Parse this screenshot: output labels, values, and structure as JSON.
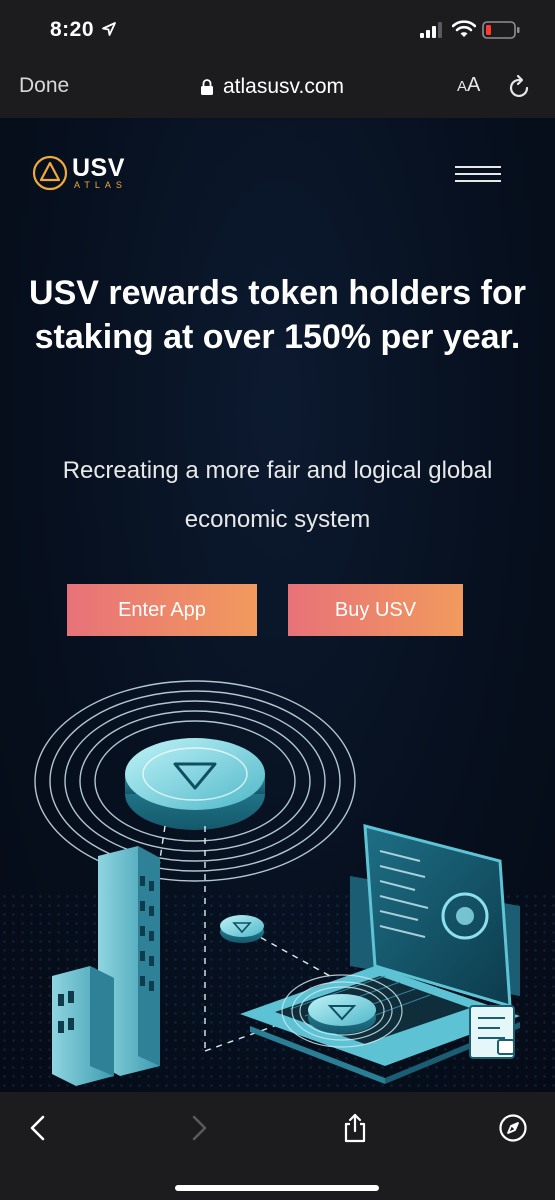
{
  "status_bar": {
    "time": "8:20"
  },
  "browser": {
    "done_label": "Done",
    "url": "atlasusv.com",
    "text_size_small": "A",
    "text_size_large": "A"
  },
  "site": {
    "logo_main": "USV",
    "logo_sub": "ATLAS",
    "headline": "USV rewards token holders for staking at over 150% per year.",
    "subheadline": "Recreating a more fair and logical global economic system",
    "enter_app_label": "Enter App",
    "buy_usv_label": "Buy USV"
  },
  "colors": {
    "accent_gold": "#f0a93b",
    "button_gradient_start": "#e87279",
    "button_gradient_end": "#f19a5d",
    "page_background": "#07101f",
    "chrome_background": "#1c1c1e"
  },
  "icons": {
    "location": "location-arrow-icon",
    "signal": "cell-signal-icon",
    "wifi": "wifi-icon",
    "battery": "battery-low-icon",
    "lock": "lock-icon",
    "reload": "reload-icon",
    "menu": "hamburger-menu-icon",
    "back": "chevron-left-icon",
    "forward": "chevron-right-icon",
    "share": "share-icon",
    "compass": "compass-icon"
  }
}
